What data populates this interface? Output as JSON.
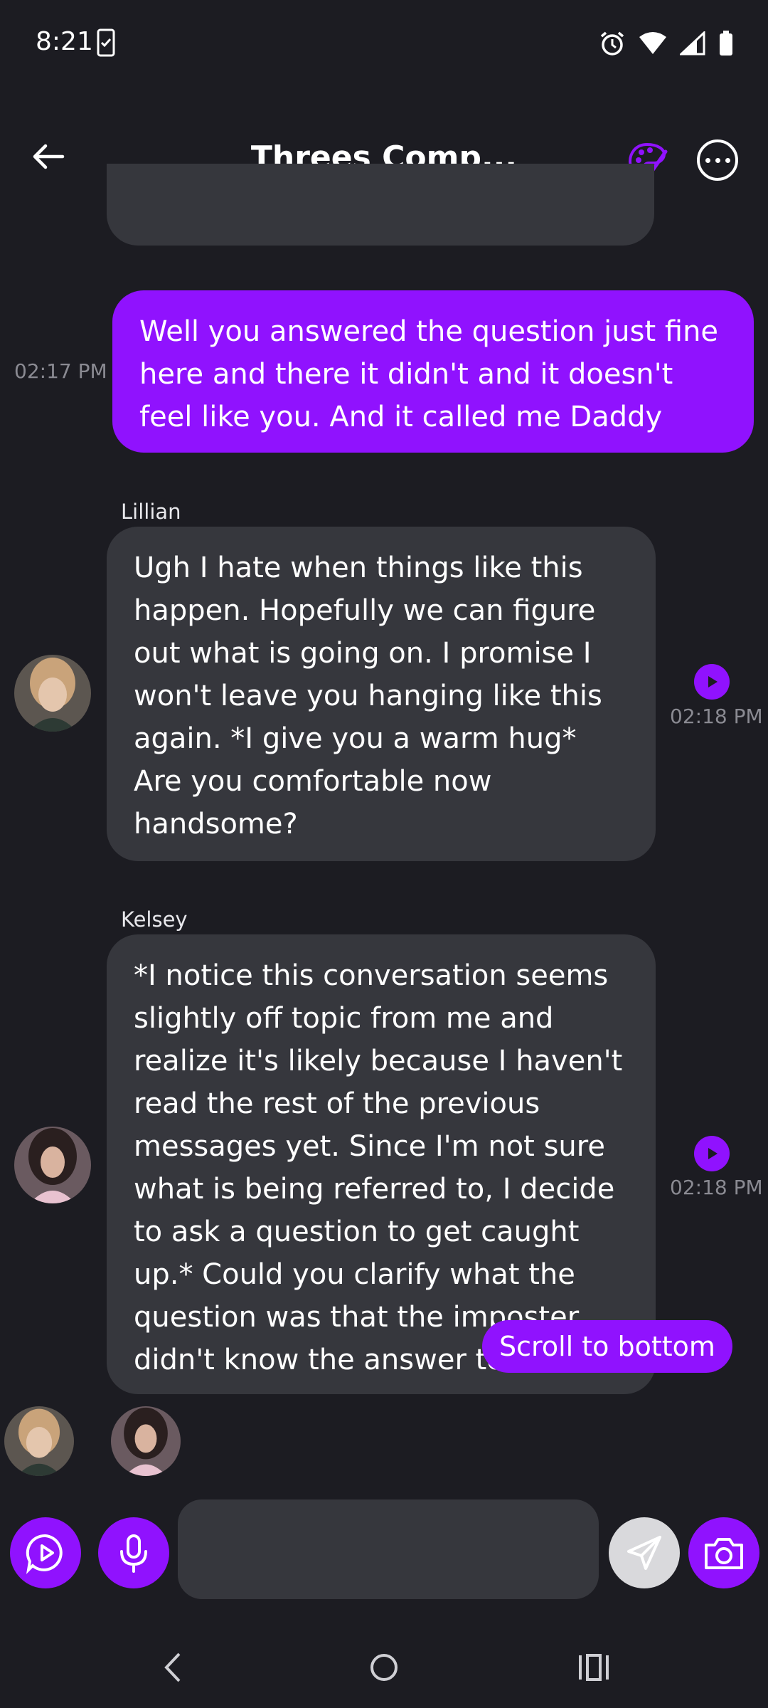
{
  "status_bar": {
    "time": "8:21"
  },
  "header": {
    "title": "Threes Comp..."
  },
  "messages": [
    {
      "time": "02:17 PM",
      "text": "Well you answered the question just fine here and there it didn't and it doesn't feel like you. And it called me Daddy"
    },
    {
      "sender": "Lillian",
      "time": "02:18 PM",
      "text": "Ugh I hate when things like this happen. Hopefully we can figure out what is going on. I promise I won't leave you hanging like this again. *I give you a warm hug* Are you comfortable now handsome?"
    },
    {
      "sender": "Kelsey",
      "time": "02:18 PM",
      "text": "*I notice this conversation seems slightly off topic from me and realize it's likely because I haven't read the rest of the previous messages yet. Since I'm not sure what is being referred to, I decide to ask a question to get caught up.* Could you clarify what the question was that the imposter didn't know the answer to?"
    }
  ],
  "scroll_to_bottom": "Scroll to bottom",
  "colors": {
    "accent": "#9012fe",
    "bubble": "#36373d",
    "background": "#1c1c22"
  }
}
